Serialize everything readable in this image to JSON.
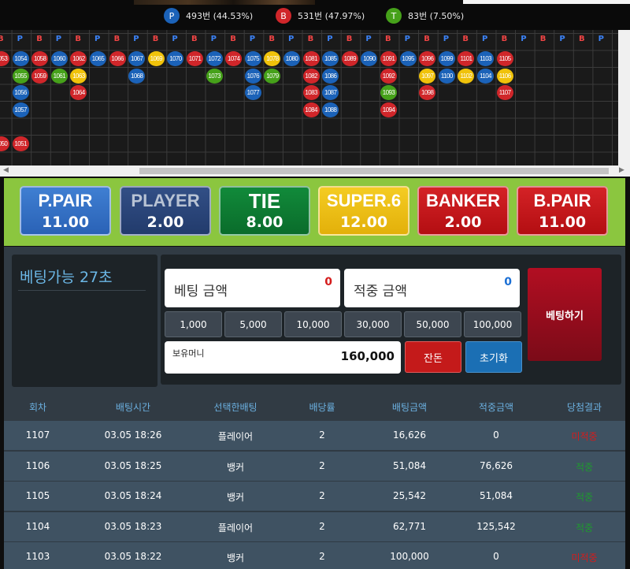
{
  "stats": [
    {
      "key": "P",
      "text": "493번 (44.53%)",
      "color": "#1b62b8"
    },
    {
      "key": "B",
      "text": "531번 (47.97%)",
      "color": "#d0262a"
    },
    {
      "key": "T",
      "text": "83번 (7.50%)",
      "color": "#46a11a"
    }
  ],
  "road": {
    "header": [
      "B",
      "P",
      "B",
      "P",
      "B",
      "P",
      "B",
      "P",
      "B",
      "P",
      "B",
      "P",
      "B",
      "P",
      "B",
      "P",
      "B",
      "P",
      "B",
      "P",
      "B",
      "P",
      "B",
      "P",
      "B",
      "P",
      "B",
      "P",
      "B",
      "P",
      "B",
      "P",
      "B",
      "P",
      "B",
      "P",
      "B",
      "P",
      "B",
      "P",
      "B",
      "P",
      "B",
      "P",
      "B",
      "P",
      "B",
      "P",
      "B",
      "P",
      "B",
      "P",
      "B"
    ],
    "cells": [
      {
        "n": "1053",
        "c": "b",
        "col": 0,
        "row": 0
      },
      {
        "n": "1054",
        "c": "p",
        "col": 1,
        "row": 0
      },
      {
        "n": "1058",
        "c": "b",
        "col": 2,
        "row": 0
      },
      {
        "n": "1060",
        "c": "p",
        "col": 3,
        "row": 0
      },
      {
        "n": "1062",
        "c": "b",
        "col": 4,
        "row": 0
      },
      {
        "n": "1065",
        "c": "p",
        "col": 5,
        "row": 0
      },
      {
        "n": "1066",
        "c": "b",
        "col": 6,
        "row": 0
      },
      {
        "n": "1067",
        "c": "p",
        "col": 7,
        "row": 0
      },
      {
        "n": "1069",
        "c": "y",
        "col": 8,
        "row": 0
      },
      {
        "n": "1070",
        "c": "p",
        "col": 9,
        "row": 0
      },
      {
        "n": "1071",
        "c": "b",
        "col": 10,
        "row": 0
      },
      {
        "n": "1072",
        "c": "p",
        "col": 11,
        "row": 0
      },
      {
        "n": "1074",
        "c": "b",
        "col": 12,
        "row": 0
      },
      {
        "n": "1075",
        "c": "p",
        "col": 13,
        "row": 0
      },
      {
        "n": "1078",
        "c": "y",
        "col": 14,
        "row": 0
      },
      {
        "n": "1080",
        "c": "p",
        "col": 15,
        "row": 0
      },
      {
        "n": "1081",
        "c": "b",
        "col": 16,
        "row": 0
      },
      {
        "n": "1085",
        "c": "p",
        "col": 17,
        "row": 0
      },
      {
        "n": "1089",
        "c": "b",
        "col": 18,
        "row": 0
      },
      {
        "n": "1090",
        "c": "p",
        "col": 19,
        "row": 0
      },
      {
        "n": "1091",
        "c": "b",
        "col": 20,
        "row": 0
      },
      {
        "n": "1095",
        "c": "p",
        "col": 21,
        "row": 0
      },
      {
        "n": "1096",
        "c": "b",
        "col": 22,
        "row": 0
      },
      {
        "n": "1099",
        "c": "p",
        "col": 23,
        "row": 0
      },
      {
        "n": "1101",
        "c": "b",
        "col": 24,
        "row": 0
      },
      {
        "n": "1103",
        "c": "p",
        "col": 25,
        "row": 0
      },
      {
        "n": "1105",
        "c": "b",
        "col": 26,
        "row": 0
      },
      {
        "n": "1055",
        "c": "g",
        "col": 1,
        "row": 1
      },
      {
        "n": "1059",
        "c": "b",
        "col": 2,
        "row": 1
      },
      {
        "n": "1061",
        "c": "g",
        "col": 3,
        "row": 1
      },
      {
        "n": "1063",
        "c": "y",
        "col": 4,
        "row": 1
      },
      {
        "n": "1068",
        "c": "p",
        "col": 7,
        "row": 1
      },
      {
        "n": "1073",
        "c": "g",
        "col": 11,
        "row": 1
      },
      {
        "n": "1076",
        "c": "p",
        "col": 13,
        "row": 1
      },
      {
        "n": "1079",
        "c": "g",
        "col": 14,
        "row": 1
      },
      {
        "n": "1082",
        "c": "b",
        "col": 16,
        "row": 1
      },
      {
        "n": "1086",
        "c": "p",
        "col": 17,
        "row": 1
      },
      {
        "n": "1092",
        "c": "b",
        "col": 20,
        "row": 1
      },
      {
        "n": "1097",
        "c": "y",
        "col": 22,
        "row": 1
      },
      {
        "n": "1100",
        "c": "p",
        "col": 23,
        "row": 1
      },
      {
        "n": "1102",
        "c": "y",
        "col": 24,
        "row": 1
      },
      {
        "n": "1104",
        "c": "p",
        "col": 25,
        "row": 1
      },
      {
        "n": "1106",
        "c": "y",
        "col": 26,
        "row": 1
      },
      {
        "n": "1056",
        "c": "p",
        "col": 1,
        "row": 2
      },
      {
        "n": "1064",
        "c": "b",
        "col": 4,
        "row": 2
      },
      {
        "n": "1077",
        "c": "p",
        "col": 13,
        "row": 2
      },
      {
        "n": "1083",
        "c": "b",
        "col": 16,
        "row": 2
      },
      {
        "n": "1087",
        "c": "p",
        "col": 17,
        "row": 2
      },
      {
        "n": "1093",
        "c": "g",
        "col": 20,
        "row": 2
      },
      {
        "n": "1098",
        "c": "b",
        "col": 22,
        "row": 2
      },
      {
        "n": "1107",
        "c": "b",
        "col": 26,
        "row": 2
      },
      {
        "n": "1057",
        "c": "p",
        "col": 1,
        "row": 3
      },
      {
        "n": "1084",
        "c": "b",
        "col": 16,
        "row": 3
      },
      {
        "n": "1088",
        "c": "p",
        "col": 17,
        "row": 3
      },
      {
        "n": "1094",
        "c": "b",
        "col": 20,
        "row": 3
      },
      {
        "n": "1050",
        "c": "b",
        "col": 0,
        "row": 5
      },
      {
        "n": "1051",
        "c": "b",
        "col": 1,
        "row": 5
      }
    ]
  },
  "bets": [
    {
      "name": "P.PAIR",
      "odds": "11.00",
      "cls": "ppair"
    },
    {
      "name": "PLAYER",
      "odds": "2.00",
      "cls": "player"
    },
    {
      "name": "TIE",
      "odds": "8.00",
      "cls": "tie"
    },
    {
      "name": "SUPER.6",
      "odds": "12.00",
      "cls": "super6"
    },
    {
      "name": "BANKER",
      "odds": "2.00",
      "cls": "banker"
    },
    {
      "name": "B.PAIR",
      "odds": "11.00",
      "cls": "bpair"
    }
  ],
  "panel": {
    "timer": "베팅가능 27초",
    "bet_amount_label": "베팅 금액",
    "bet_amount_value": "0",
    "win_amount_label": "적중 금액",
    "win_amount_value": "0",
    "chips": [
      "1,000",
      "5,000",
      "10,000",
      "30,000",
      "50,000",
      "100,000"
    ],
    "money_label": "보유머니",
    "money_value": "160,000",
    "change_label": "잔돈",
    "reset_label": "초기화",
    "bet_button": "베팅하기"
  },
  "table": {
    "headers": [
      "회차",
      "배팅시간",
      "선택한배팅",
      "배당률",
      "배팅금액",
      "적중금액",
      "당첨결과"
    ],
    "rows": [
      [
        "1107",
        "03.05 18:26",
        "플레이어",
        "2",
        "16,626",
        "0",
        "미적중"
      ],
      [
        "1106",
        "03.05 18:25",
        "뱅커",
        "2",
        "51,084",
        "76,626",
        "적중"
      ],
      [
        "1105",
        "03.05 18:24",
        "뱅커",
        "2",
        "25,542",
        "51,084",
        "적중"
      ],
      [
        "1104",
        "03.05 18:23",
        "플레이어",
        "2",
        "62,771",
        "125,542",
        "적중"
      ],
      [
        "1103",
        "03.05 18:22",
        "뱅커",
        "2",
        "100,000",
        "0",
        "미적중"
      ]
    ]
  }
}
